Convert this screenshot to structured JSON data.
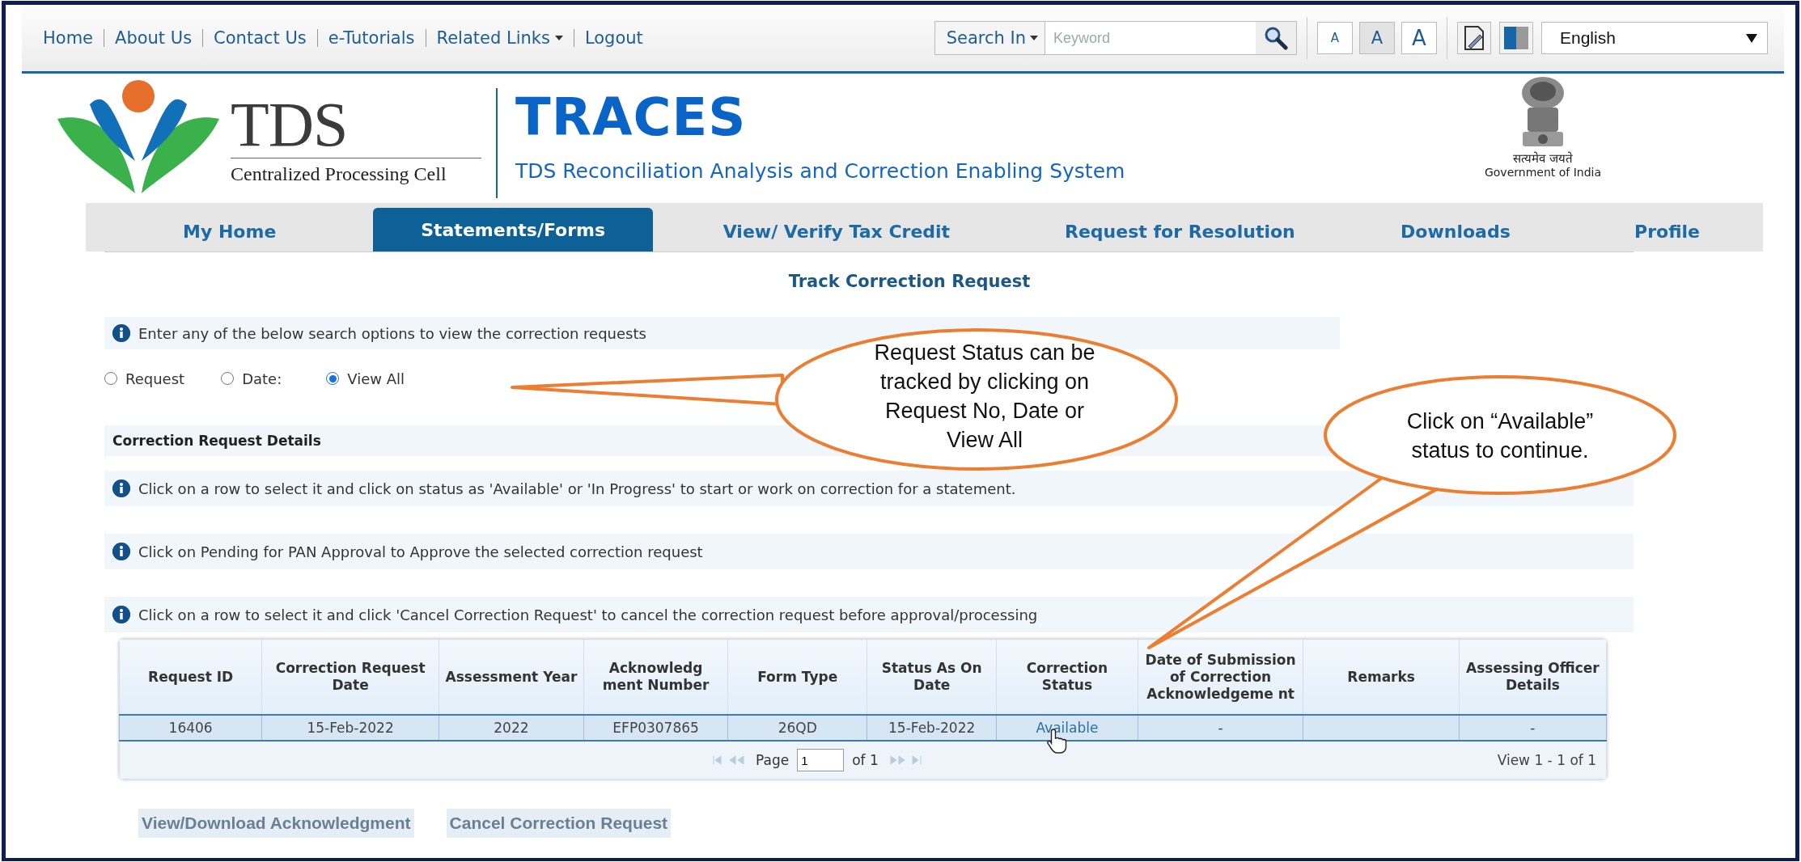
{
  "top_links": [
    {
      "label": "Home",
      "has_menu": false
    },
    {
      "label": "About Us",
      "has_menu": false
    },
    {
      "label": "Contact Us",
      "has_menu": false
    },
    {
      "label": "e-Tutorials",
      "has_menu": false
    },
    {
      "label": "Related Links",
      "has_menu": true
    },
    {
      "label": "Logout",
      "has_menu": false
    }
  ],
  "search": {
    "scope": "Search In",
    "placeholder": "Keyword"
  },
  "font_sizes": [
    {
      "label": "A",
      "selected": false
    },
    {
      "label": "A",
      "selected": true
    },
    {
      "label": "A",
      "selected": false
    }
  ],
  "language": "English",
  "logo": {
    "title": "TDS",
    "subtitle": "Centralized Processing Cell"
  },
  "site": {
    "title": "TRACES",
    "subtitle": "TDS Reconciliation Analysis and Correction Enabling System"
  },
  "emblem": {
    "motto": "सत्यमेव जयते",
    "caption": "Government of India"
  },
  "nav": [
    {
      "label": "My Home",
      "selected": false
    },
    {
      "label": "Statements/Forms",
      "selected": true
    },
    {
      "label": "View/ Verify Tax Credit",
      "selected": false
    },
    {
      "label": "Request for Resolution",
      "selected": false
    },
    {
      "label": "Downloads",
      "selected": false
    },
    {
      "label": "Profile",
      "selected": false
    }
  ],
  "page_title": "Track Correction Request",
  "search_hint": "Enter any of the below search options to view the correction requests",
  "search_options": [
    {
      "label": "Request",
      "selected": false
    },
    {
      "label": "Date:",
      "selected": false
    },
    {
      "label": "View All",
      "selected": true
    }
  ],
  "section_title": "Correction Request Details",
  "notes": [
    "Click on a row to select it and click on status as 'Available' or 'In Progress' to start or work on correction for a statement.",
    "Click on Pending for PAN Approval to Approve the selected correction request",
    "Click on a row to select it and click 'Cancel Correction Request' to cancel the correction request before approval/processing"
  ],
  "table": {
    "columns": [
      "Request ID",
      "Correction Request Date",
      "Assessment Year",
      "Acknowledg ment Number",
      "Form Type",
      "Status As On Date",
      "Correction Status",
      "Date of Submission of Correction Acknowledgeme nt",
      "Remarks",
      "Assessing Officer Details"
    ],
    "rows": [
      {
        "selected": true,
        "cells": [
          "16406",
          "15-Feb-2022",
          "2022",
          "EFP0307865",
          "26QD",
          "15-Feb-2022",
          "Available",
          "-",
          null,
          "-"
        ]
      }
    ]
  },
  "pager": {
    "page_label": "Page",
    "page": "1",
    "total": "of 1",
    "view": "View 1 - 1 of 1"
  },
  "buttons": [
    "View/Download Acknowledgment",
    "Cancel Correction Request"
  ],
  "callouts": [
    {
      "lines": [
        "Request Status can be",
        "tracked by clicking on",
        "Request No, Date or",
        "View All"
      ]
    },
    {
      "lines": [
        "Click on “Available”",
        "status to continue."
      ]
    }
  ]
}
